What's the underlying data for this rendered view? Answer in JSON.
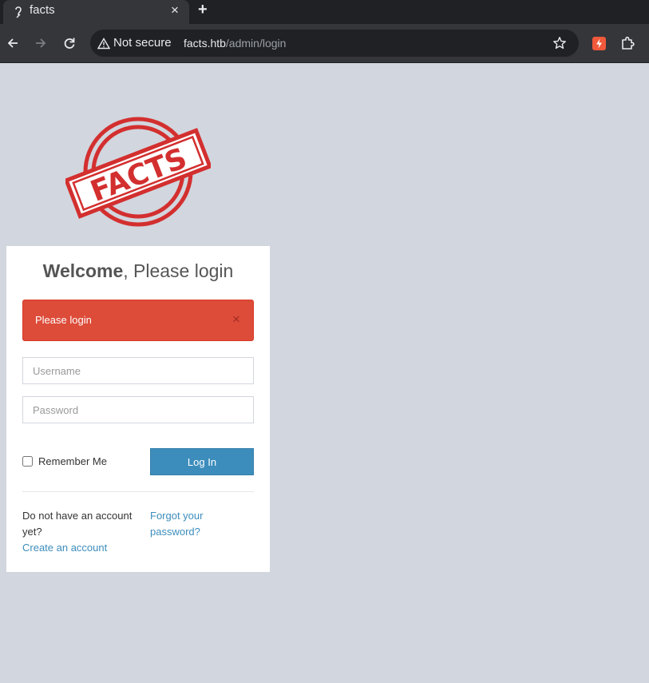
{
  "browser": {
    "tab_title": "facts",
    "tab_close": "×",
    "new_tab": "+",
    "security_label": "Not secure",
    "url_host": "facts.htb",
    "url_path": "/admin/login"
  },
  "logo": {
    "text": "FACTS",
    "color": "#d32f2f"
  },
  "login": {
    "title_bold": "Welcome",
    "title_rest": ", Please login",
    "alert_text": "Please login",
    "alert_close": "×",
    "username_placeholder": "Username",
    "password_placeholder": "Password",
    "remember_label": "Remember Me",
    "submit_label": "Log In",
    "no_account_text": "Do not have an account yet?",
    "create_account_link": "Create an account",
    "forgot_password_link": "Forgot your password?"
  },
  "colors": {
    "page_bg": "#d2d6de",
    "alert_bg": "#dd4b39",
    "button_bg": "#3c8dbc",
    "link": "#3c8dbc"
  }
}
